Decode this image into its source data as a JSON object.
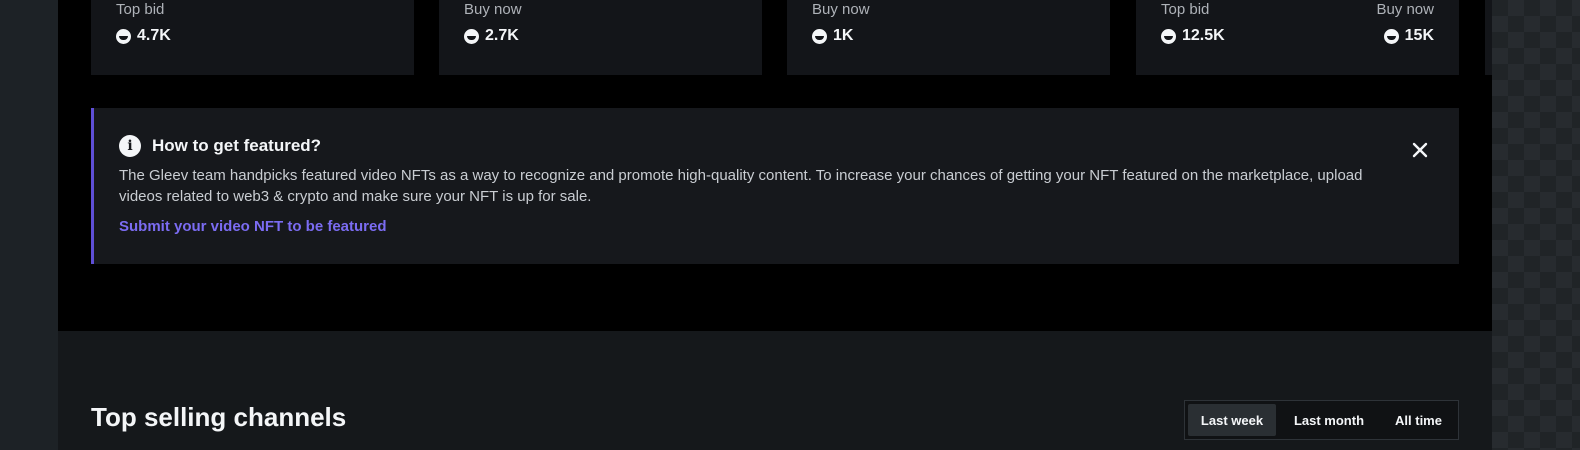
{
  "nft_cards": [
    {
      "left": {
        "label": "Top bid",
        "value": "4.7K"
      }
    },
    {
      "left": {
        "label": "Buy now",
        "value": "2.7K"
      }
    },
    {
      "left": {
        "label": "Buy now",
        "value": "1K"
      }
    },
    {
      "left": {
        "label": "Top bid",
        "value": "12.5K"
      },
      "right": {
        "label": "Buy now",
        "value": "15K"
      }
    }
  ],
  "featured_notice": {
    "title": "How to get featured?",
    "body": "The Gleev team handpicks featured video NFTs as a way to recognize and promote high-quality content. To increase your chances of getting your NFT featured on the marketplace, upload videos related to web3 & crypto and make sure your NFT is up for sale.",
    "link": "Submit your video NFT to be featured",
    "accent_color": "#5f4fd6",
    "link_color": "#7b6cf2",
    "info_icon": "info-icon",
    "close_icon": "close-icon"
  },
  "top_selling": {
    "title": "Top selling channels",
    "tabs": [
      {
        "label": "Last week",
        "active": true
      },
      {
        "label": "Last month",
        "active": false
      },
      {
        "label": "All time",
        "active": false
      }
    ]
  },
  "token_icon": "joystream-token-icon"
}
